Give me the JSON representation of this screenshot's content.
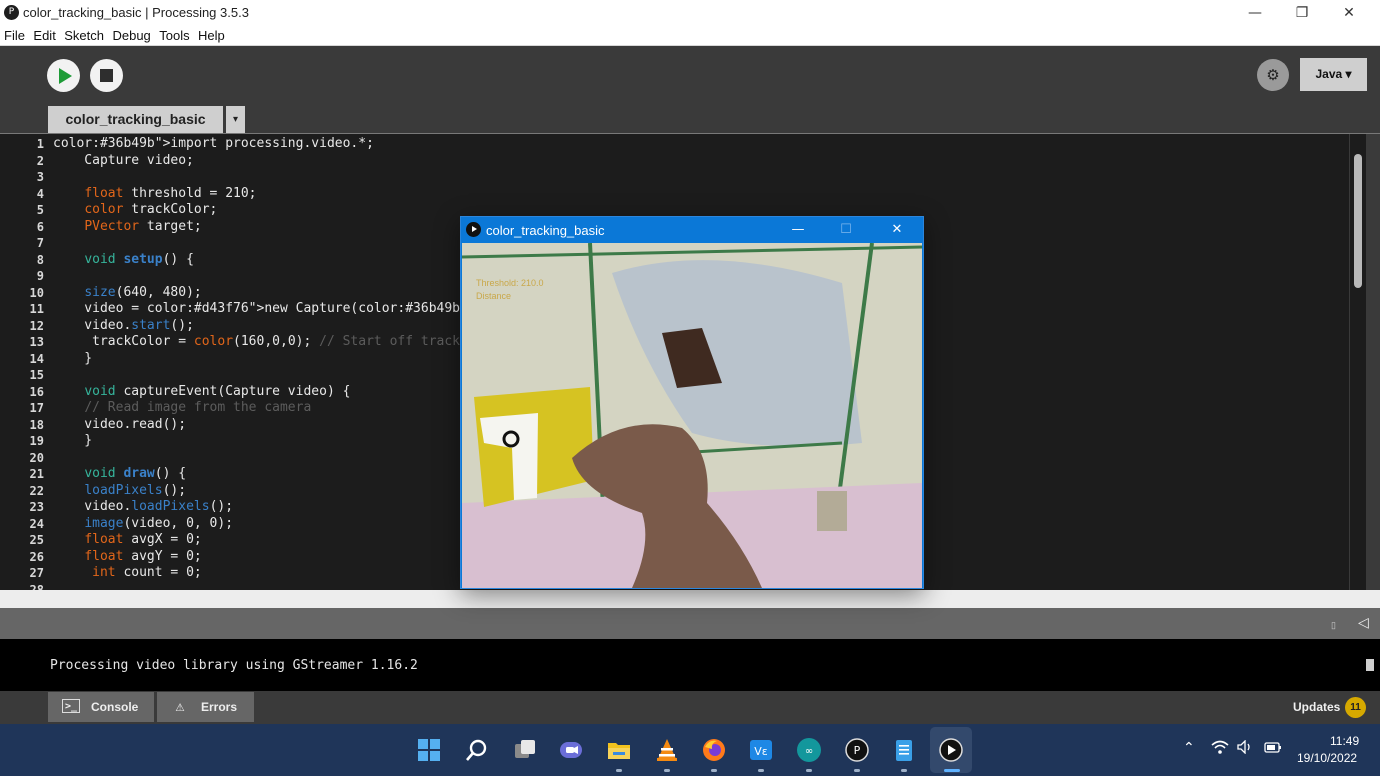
{
  "window": {
    "title": "color_tracking_basic | Processing 3.5.3",
    "minimize": "—",
    "maximize": "❐",
    "close": "✕"
  },
  "menu": [
    "File",
    "Edit",
    "Sketch",
    "Debug",
    "Tools",
    "Help"
  ],
  "toolbar": {
    "mode_label": "Java ▾",
    "debug_icon": "debug-icon"
  },
  "tabs": {
    "active": "color_tracking_basic",
    "dropdown": "▾"
  },
  "editor": {
    "line_numbers": [
      "1",
      "2",
      "3",
      "4",
      "5",
      "6",
      "7",
      "8",
      "9",
      "10",
      "11",
      "12",
      "13",
      "14",
      "15",
      "16",
      "17",
      "18",
      "19",
      "20",
      "21",
      "22",
      "23",
      "24",
      "25",
      "26",
      "27",
      "28"
    ],
    "code_lines": [
      "import processing.video.*;",
      "    Capture video;",
      "",
      "    float threshold = 210;",
      "    color trackColor;",
      "    PVector target;",
      "",
      "    void setup() {",
      "",
      "    size(640, 480);",
      "    video = new Capture(this, width, height);",
      "    video.start();",
      "     trackColor = color(160,0,0); // Start off tracking for red",
      "    }",
      "",
      "    void captureEvent(Capture video) {",
      "    // Read image from the camera",
      "    video.read();",
      "    }",
      "",
      "    void draw() {",
      "    loadPixels();",
      "    video.loadPixels();",
      "    image(video, 0, 0);",
      "    float avgX = 0;",
      "    float avgY = 0;",
      "     int count = 0;",
      ""
    ]
  },
  "sketch_window": {
    "title": "color_tracking_basic",
    "minimize": "—",
    "maximize": "☐",
    "close": "✕",
    "overlay_text_1": "Threshold: 210.0",
    "overlay_text_2": "Distance"
  },
  "console": {
    "message": "Processing video library using GStreamer 1.16.2",
    "tab_console": "Console",
    "tab_errors": "Errors",
    "updates_label": "Updates",
    "updates_count": "11"
  },
  "taskbar": {
    "time": "11:49",
    "date": "19/10/2022",
    "apps": [
      "start-icon",
      "search-icon",
      "task-view-icon",
      "teams-chat-icon",
      "file-explorer-icon",
      "vlc-icon",
      "firefox-icon",
      "vscode-icon",
      "arduino-icon",
      "processing-icon",
      "notepad-icon",
      "sketch-run-icon"
    ]
  },
  "colors": {
    "editor_bg": "#1c1c1c",
    "keyword": "#e2661a",
    "type_keyword": "#36b49b",
    "function": "#3a81c9",
    "literal": "#d43f76",
    "comment": "#5c5c5c",
    "accent_blue": "#0b78d7"
  }
}
